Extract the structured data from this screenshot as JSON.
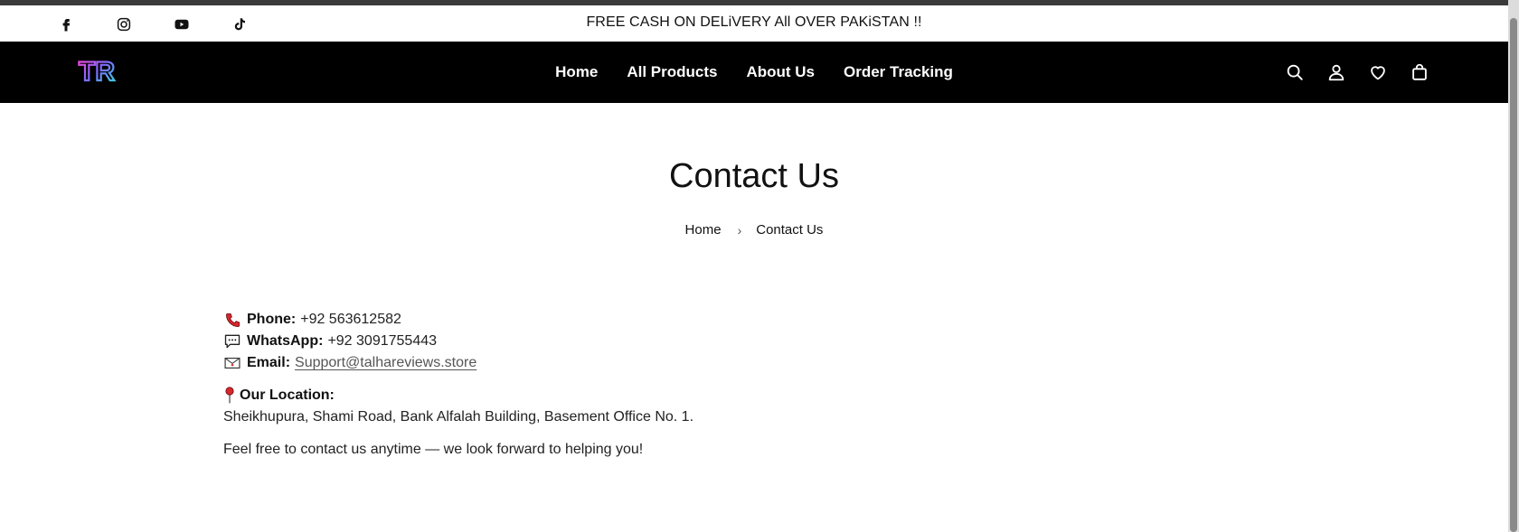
{
  "announcement": {
    "text": "FREE CASH ON DELiVERY All OVER PAKiSTAN !!"
  },
  "social_icons": [
    "facebook-icon",
    "instagram-icon",
    "youtube-icon",
    "tiktok-icon"
  ],
  "header": {
    "logo_text": "TR",
    "nav": [
      "Home",
      "All Products",
      "About Us",
      "Order Tracking"
    ],
    "icons": [
      "search-icon",
      "account-icon",
      "wishlist-icon",
      "cart-icon"
    ]
  },
  "page": {
    "title": "Contact Us",
    "breadcrumb": {
      "home": "Home",
      "current": "Contact Us"
    }
  },
  "contact": {
    "phone": {
      "label": "Phone:",
      "value": "+92 563612582"
    },
    "whatsapp": {
      "label": "WhatsApp:",
      "value": "+92 3091755443"
    },
    "email": {
      "label": "Email:",
      "value": "Support@talhareviews.store"
    },
    "location": {
      "label": "Our Location:",
      "value": "Sheikhupura, Shami Road, Bank Alfalah Building, Basement Office No. 1."
    },
    "closing": "Feel free to contact us anytime — we look forward to helping you!"
  },
  "colors": {
    "nav_bg": "#000000",
    "text": "#111111",
    "link": "#555555"
  }
}
